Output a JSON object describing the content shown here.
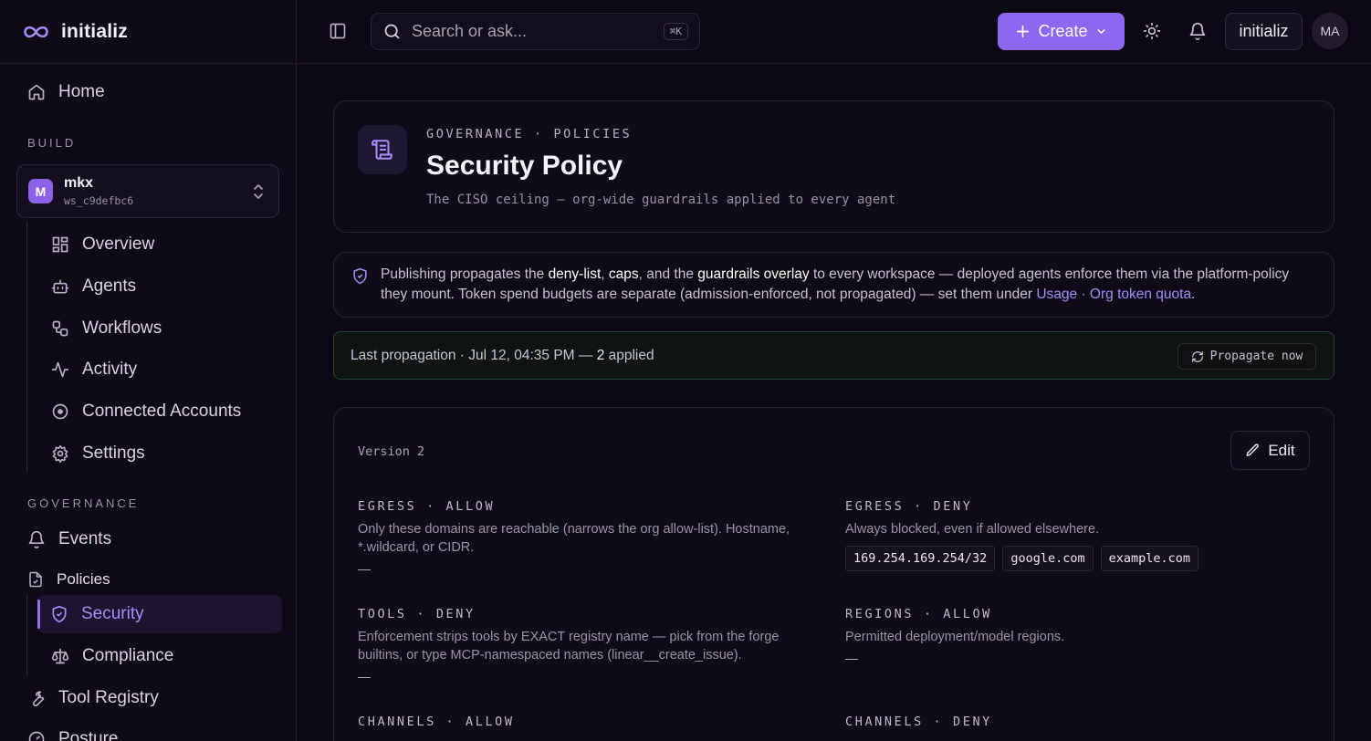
{
  "brand": {
    "name": "initializ"
  },
  "sidebar": {
    "home": "Home",
    "build_label": "BUILD",
    "workspace": {
      "avatar": "M",
      "name": "mkx",
      "id": "ws_c9defbc6"
    },
    "build_items": [
      {
        "label": "Overview",
        "icon": "grid-icon"
      },
      {
        "label": "Agents",
        "icon": "robot-icon"
      },
      {
        "label": "Workflows",
        "icon": "workflow-icon"
      },
      {
        "label": "Activity",
        "icon": "activity-icon"
      },
      {
        "label": "Connected Accounts",
        "icon": "plug-circle-icon"
      },
      {
        "label": "Settings",
        "icon": "gear-icon"
      }
    ],
    "governance_label": "GOVERNANCE",
    "events": "Events",
    "policies": "Policies",
    "policy_items": [
      {
        "label": "Security",
        "icon": "shield-check-icon",
        "active": true
      },
      {
        "label": "Compliance",
        "icon": "scale-icon"
      }
    ],
    "tool_registry": "Tool Registry",
    "posture": "Posture"
  },
  "topbar": {
    "search_placeholder": "Search or ask...",
    "search_shortcut": "⌘K",
    "create_label": "Create",
    "org_label": "initializ",
    "user_initials": "MA"
  },
  "header": {
    "eyebrow": "GOVERNANCE · POLICIES",
    "title": "Security Policy",
    "subtitle": "The CISO ceiling — org-wide guardrails applied to every agent"
  },
  "notice": {
    "t1": "Publishing propagates the ",
    "deny_list": "deny-list",
    "t2": ", ",
    "caps": "caps",
    "t3": ", and the ",
    "guardrails": "guardrails overlay",
    "t4": " to every workspace — deployed agents enforce them via the platform-policy they mount. Token spend budgets are separate (admission-enforced, not propagated) — set them under ",
    "link_usage": "Usage",
    "sep": " · ",
    "link_quota": "Org token quota",
    "t5": "."
  },
  "propagation": {
    "prefix": "Last propagation · Jul 12, 04:35 PM — ",
    "count": "2",
    "suffix": " applied",
    "button": "Propagate now"
  },
  "policy": {
    "version": "Version 2",
    "edit_label": "Edit",
    "rules": {
      "egress_allow": {
        "head": "EGRESS · ALLOW",
        "desc": "Only these domains are reachable (narrows the org allow-list). Hostname, *.wildcard, or CIDR.",
        "empty": "—"
      },
      "egress_deny": {
        "head": "EGRESS · DENY",
        "desc": "Always blocked, even if allowed elsewhere.",
        "chips": [
          "169.254.169.254/32",
          "google.com",
          "example.com"
        ]
      },
      "tools_deny": {
        "head": "TOOLS · DENY",
        "desc": "Enforcement strips tools by EXACT registry name — pick from the forge builtins, or type MCP-namespaced names (linear__create_issue).",
        "empty": "—"
      },
      "regions_allow": {
        "head": "REGIONS · ALLOW",
        "desc": "Permitted deployment/model regions.",
        "empty": "—"
      },
      "channels_allow": {
        "head": "CHANNELS · ALLOW"
      },
      "channels_deny": {
        "head": "CHANNELS · DENY"
      }
    }
  }
}
